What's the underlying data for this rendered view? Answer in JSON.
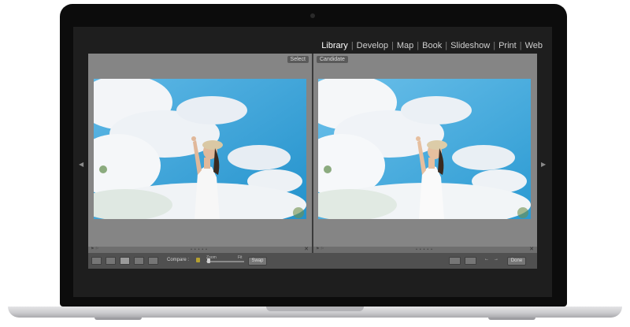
{
  "modules": [
    "Library",
    "Develop",
    "Map",
    "Book",
    "Slideshow",
    "Print",
    "Web"
  ],
  "active_module": "Library",
  "separator": "|",
  "select_label": "Select",
  "candidate_label": "Candidate",
  "toolbar": {
    "compare_label": "Compare :",
    "zoom_label": "Zoom",
    "fit_label": "Fit",
    "swap_label": "Swap",
    "done_label": "Done"
  },
  "colors": {
    "sky": "#2f9fd6",
    "cloud": "#f4f6f8",
    "panel_gray": "#858585",
    "toolbar_gray": "#505050"
  },
  "icons": [
    "left-panel-arrow-icon",
    "right-panel-arrow-icon",
    "grid-view-icon",
    "loupe-view-icon",
    "compare-view-icon",
    "survey-view-icon",
    "people-view-icon",
    "lock-icon",
    "close-icon",
    "flag-icon",
    "prev-arrow-icon",
    "next-arrow-icon"
  ]
}
